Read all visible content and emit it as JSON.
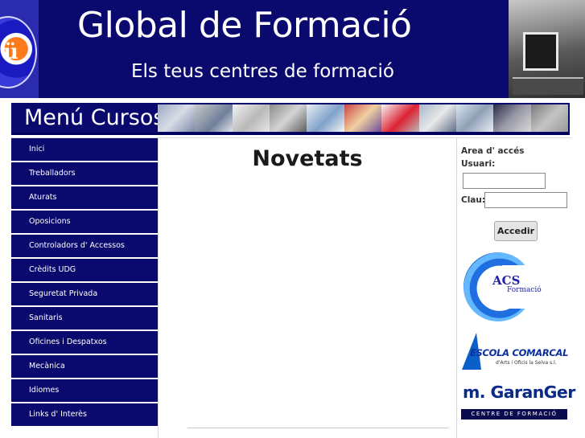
{
  "header": {
    "title": "Global de Formació",
    "subtitle": "Els teus centres de formació",
    "logo_icon": "gf-logo-icon",
    "photo_icon": "classroom-photo-icon"
  },
  "menu": {
    "title": "Menú Cursos",
    "items": [
      {
        "label": "Inici"
      },
      {
        "label": "Treballadors"
      },
      {
        "label": "Aturats"
      },
      {
        "label": "Oposicions"
      },
      {
        "label": "Controladors d' Accessos"
      },
      {
        "label": "Crèdits UDG"
      },
      {
        "label": "Seguretat Privada"
      },
      {
        "label": "Sanitaris"
      },
      {
        "label": "Oficines i Despatxos"
      },
      {
        "label": "Mecànica"
      },
      {
        "label": "Idiomes"
      },
      {
        "label": "Links d' Interès"
      }
    ]
  },
  "main": {
    "title": "Novetats"
  },
  "login": {
    "area_label": "Area d' accés",
    "user_label": "Usuari:",
    "user_value": "",
    "password_label": "Clau:",
    "password_value": "",
    "submit_label": "Accedir"
  },
  "partners": {
    "acs": {
      "name": "ACS",
      "sub": "Formació"
    },
    "escola": {
      "name": "ESCOLA COMARCAL",
      "sub": "d'Arts i Oficis la Selva s.l."
    },
    "garanger": {
      "name": "m. GaranGer",
      "sub": "CENTRE DE FORMACIÓ"
    }
  },
  "colors": {
    "navy": "#0a0a6e",
    "background": "#ffffff",
    "nav_text": "#ffffff"
  }
}
